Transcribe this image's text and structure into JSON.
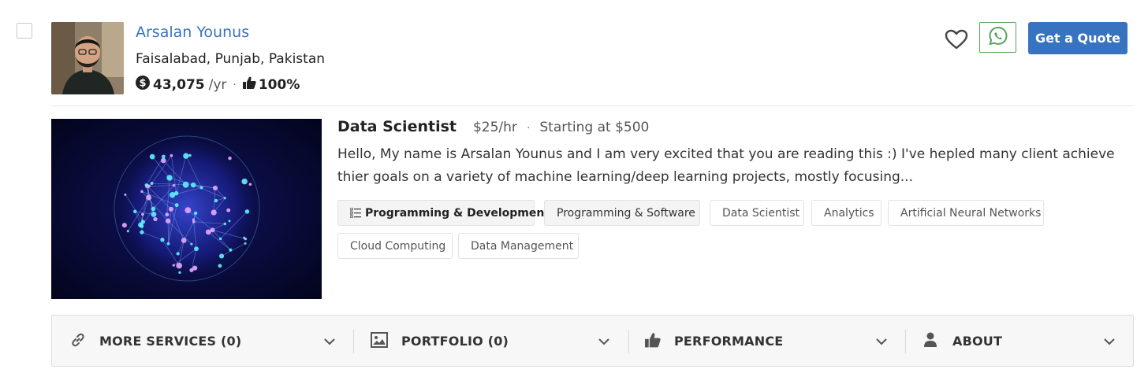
{
  "freelancer": {
    "name": "Arsalan Younus",
    "location": "Faisalabad, Punjab, Pakistan",
    "earnings_value": "43,075",
    "earnings_unit": "/yr",
    "rating": "100%"
  },
  "actions": {
    "quote_label": "Get a Quote"
  },
  "service": {
    "title": "Data Scientist",
    "rate": "$25/hr",
    "separator": "·",
    "starting": "Starting at $500",
    "description": "Hello, My name is Arsalan Younus and I am very excited that you are reading this :) I've hepled many client achieve thier goals on a variety of machine learning/deep learning projects, mostly focusing..."
  },
  "tags": [
    "Programming & Development",
    "Programming & Software",
    "Data Scientist",
    "Analytics",
    "Artificial Neural Networks",
    "Cloud Computing",
    "Data Management"
  ],
  "tabs": [
    {
      "label": "MORE SERVICES (0)",
      "icon": "link-icon"
    },
    {
      "label": "PORTFOLIO (0)",
      "icon": "image-icon"
    },
    {
      "label": "PERFORMANCE",
      "icon": "thumbs-up-icon"
    },
    {
      "label": "ABOUT",
      "icon": "user-icon"
    }
  ],
  "colors": {
    "accent": "#3873c0",
    "name_link": "#3b73b9",
    "whatsapp": "#58a55c"
  }
}
